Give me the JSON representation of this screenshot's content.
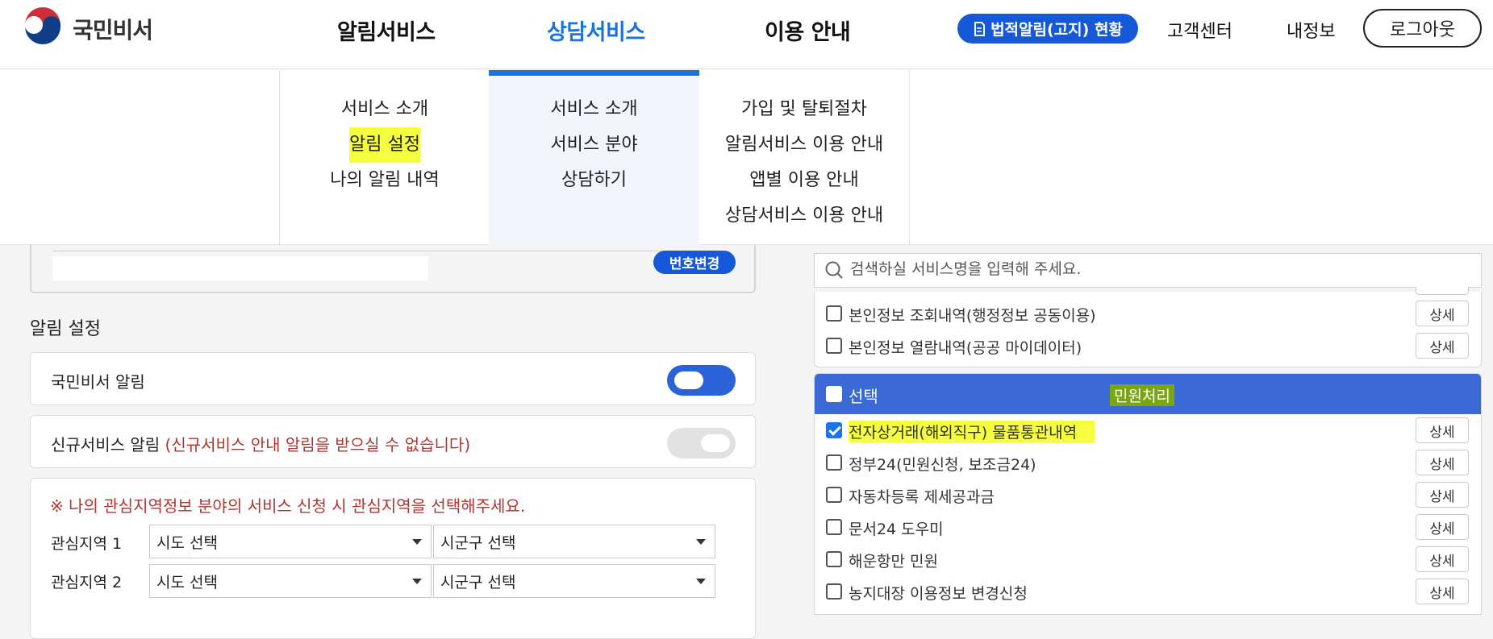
{
  "header": {
    "logo_text": "국민비서",
    "nav": [
      "알림서비스",
      "상담서비스",
      "이용 안내"
    ],
    "legal_button": "법적알림(고지) 현황",
    "customer_center": "고객센터",
    "my_info": "내정보",
    "logout": "로그아웃",
    "accent_color": "#1a73d9"
  },
  "mega_menu": {
    "col1": [
      "서비스 소개",
      "알림 설정",
      "나의 알림 내역"
    ],
    "col2": [
      "서비스 소개",
      "서비스 분야",
      "상담하기"
    ],
    "col3": [
      "가입 및 탈퇴절차",
      "알림서비스 이용 안내",
      "앱별 이용 안내",
      "상담서비스 이용 안내"
    ]
  },
  "phone": {
    "change_button": "번호변경"
  },
  "settings": {
    "title": "알림 설정",
    "toggle1_label": "국민비서 알림",
    "toggle1_on": true,
    "toggle2_label": "신규서비스 알림",
    "toggle2_warning": "(신규서비스 안내 알림을 받으실 수 없습니다)",
    "toggle2_on": false,
    "region_note": "※ 나의 관심지역정보 분야의 서비스 신청 시 관심지역을 선택해주세요.",
    "region1_label": "관심지역 1",
    "region2_label": "관심지역 2",
    "sido_placeholder": "시도 선택",
    "sigungu_placeholder": "시군구 선택"
  },
  "services": {
    "search_placeholder": "검색하실 서비스명을 입력해 주세요.",
    "detail_label": "상세",
    "top_items": [
      {
        "name": "본인정보 조회내역(행정정보 공동이용)",
        "checked": false
      },
      {
        "name": "본인정보 열람내역(공공 마이데이터)",
        "checked": false
      }
    ],
    "category": {
      "select_label": "선택",
      "name": "민원처리",
      "items": [
        {
          "name": "전자상거래(해외직구) 물품통관내역",
          "checked": true
        },
        {
          "name": "정부24(민원신청, 보조금24)",
          "checked": false
        },
        {
          "name": "자동차등록 제세공과금",
          "checked": false
        },
        {
          "name": "문서24 도우미",
          "checked": false
        },
        {
          "name": "해운항만 민원",
          "checked": false
        },
        {
          "name": "농지대장 이용정보 변경신청",
          "checked": false
        }
      ]
    }
  }
}
